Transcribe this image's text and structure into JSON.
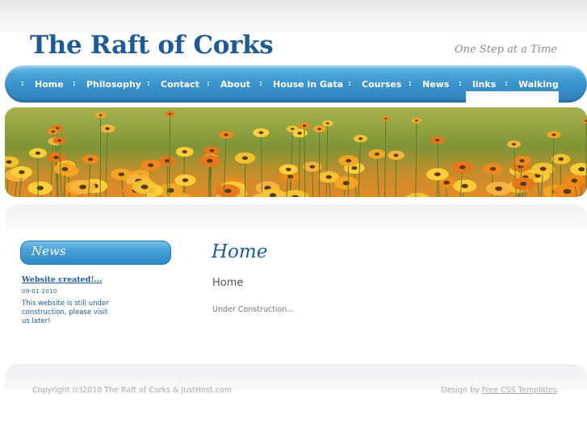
{
  "header": {
    "title": "The Raft of Corks",
    "tagline": "One Step at a Time"
  },
  "nav": {
    "separator": ":",
    "items": [
      {
        "label": "Home"
      },
      {
        "label": "Philosophy"
      },
      {
        "label": "Contact"
      },
      {
        "label": "About"
      },
      {
        "label": "House in Gata"
      },
      {
        "label": "Courses"
      },
      {
        "label": "News"
      },
      {
        "label": "links"
      },
      {
        "label": "Walking"
      }
    ]
  },
  "sidebar": {
    "news_heading": "News",
    "entry": {
      "title": "Website created!...",
      "date": "09-01-2010",
      "text": "This website is still under construction, please visit us later!"
    }
  },
  "main": {
    "heading": "Home",
    "subheading": "Home",
    "body": "Under Construction..."
  },
  "footer": {
    "copyright": "Copyright (c)2010 The Raft of Corks & JustHost.com",
    "design_prefix": "Design by",
    "design_link": "Free CSS Templates",
    "design_suffix": "."
  },
  "colors": {
    "brand_blue": "#1e5b96",
    "nav_blue": "#3a92cc",
    "muted_text": "#aaaaaa"
  }
}
